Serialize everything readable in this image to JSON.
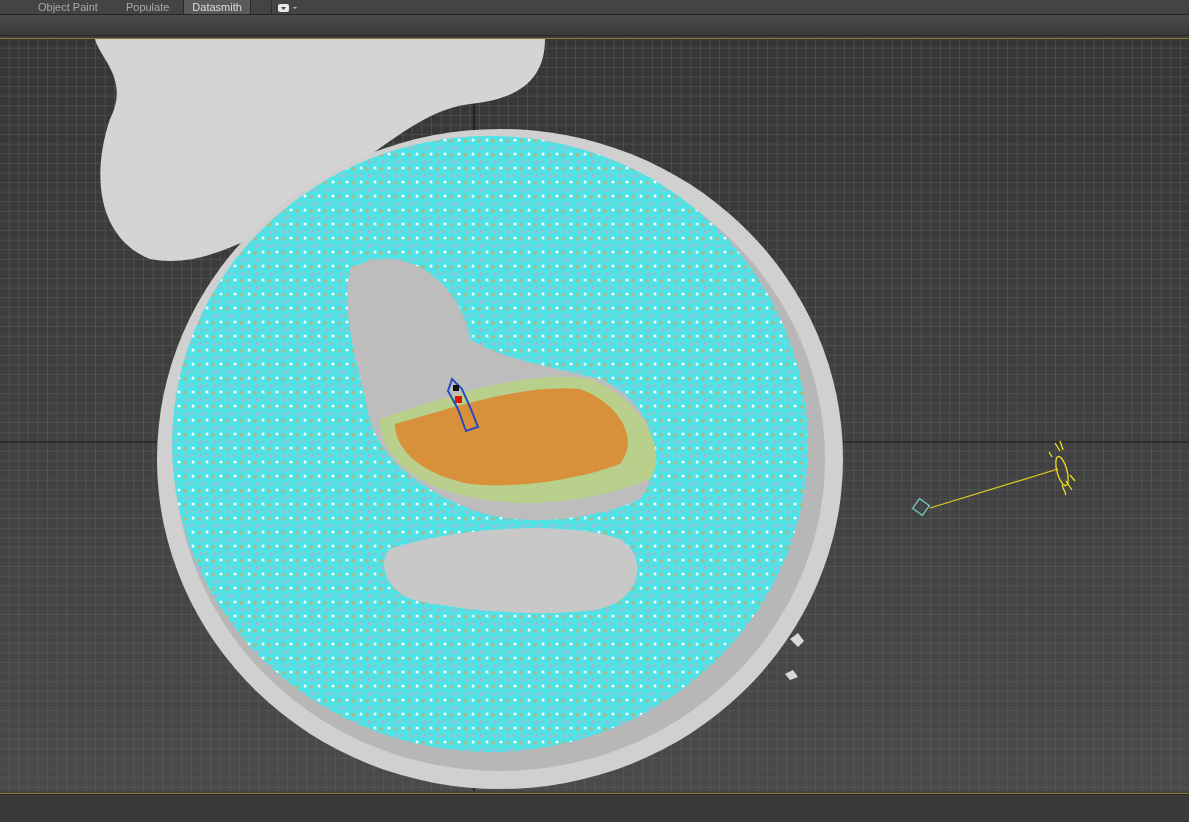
{
  "ribbon_tabs": [
    {
      "label": "Object Paint",
      "selected": false
    },
    {
      "label": "Populate",
      "selected": false
    },
    {
      "label": "Datasmith",
      "selected": true
    }
  ]
}
